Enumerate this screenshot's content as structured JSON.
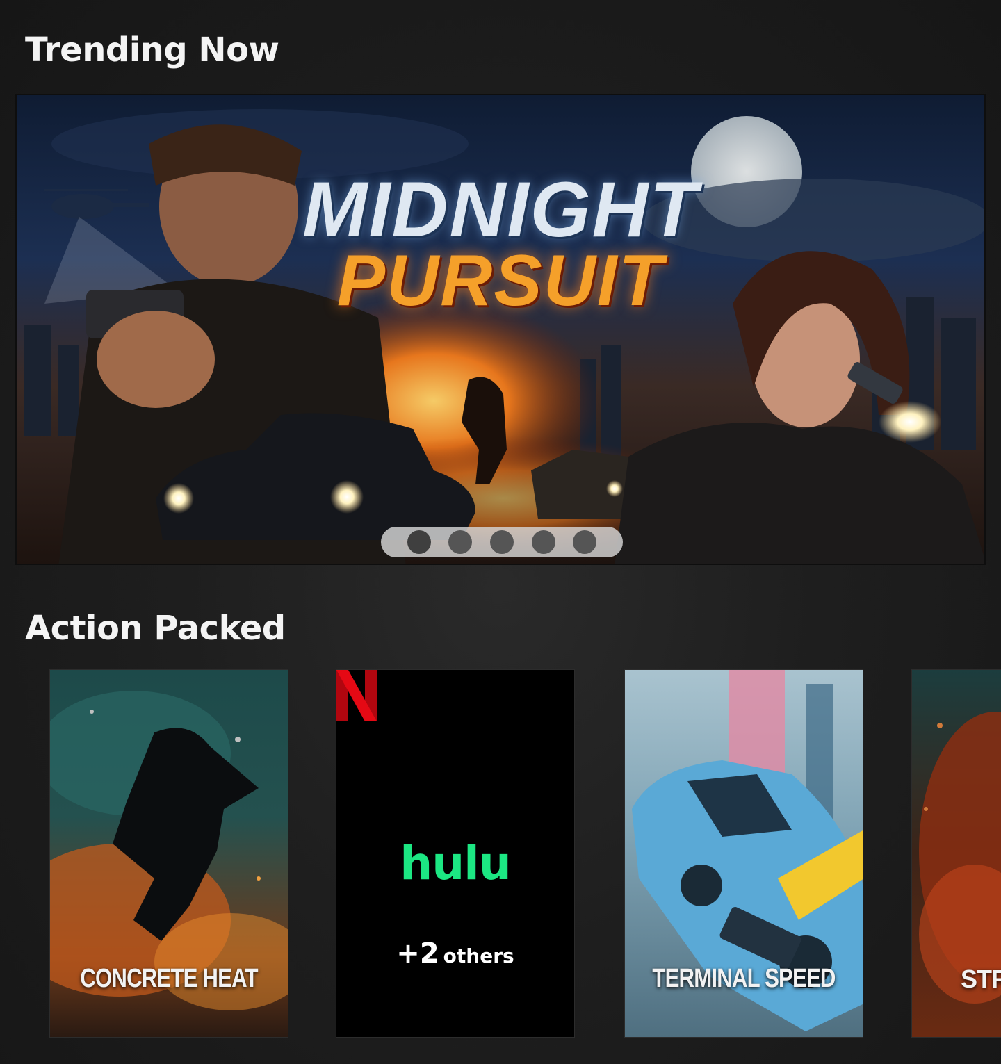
{
  "sections": {
    "trending": {
      "title": "Trending Now"
    },
    "action": {
      "title": "Action Packed"
    }
  },
  "hero": {
    "title_line1": "MIDNIGHT",
    "title_line2": "PURSUIT",
    "slide_count": 5,
    "active_slide": 1
  },
  "cards": [
    {
      "title": "CONCRETE HEAT"
    },
    {
      "services": [
        "N",
        "hulu"
      ],
      "others_count": "+2",
      "others_label": "others"
    },
    {
      "title": "TERMINAL SPEED"
    },
    {
      "title": "STR"
    }
  ],
  "colors": {
    "background": "#1e1e1e",
    "netflix_red": "#e50914",
    "hulu_green": "#1ce783",
    "dots_track": "#d7d7d7",
    "dot": "#555555"
  }
}
